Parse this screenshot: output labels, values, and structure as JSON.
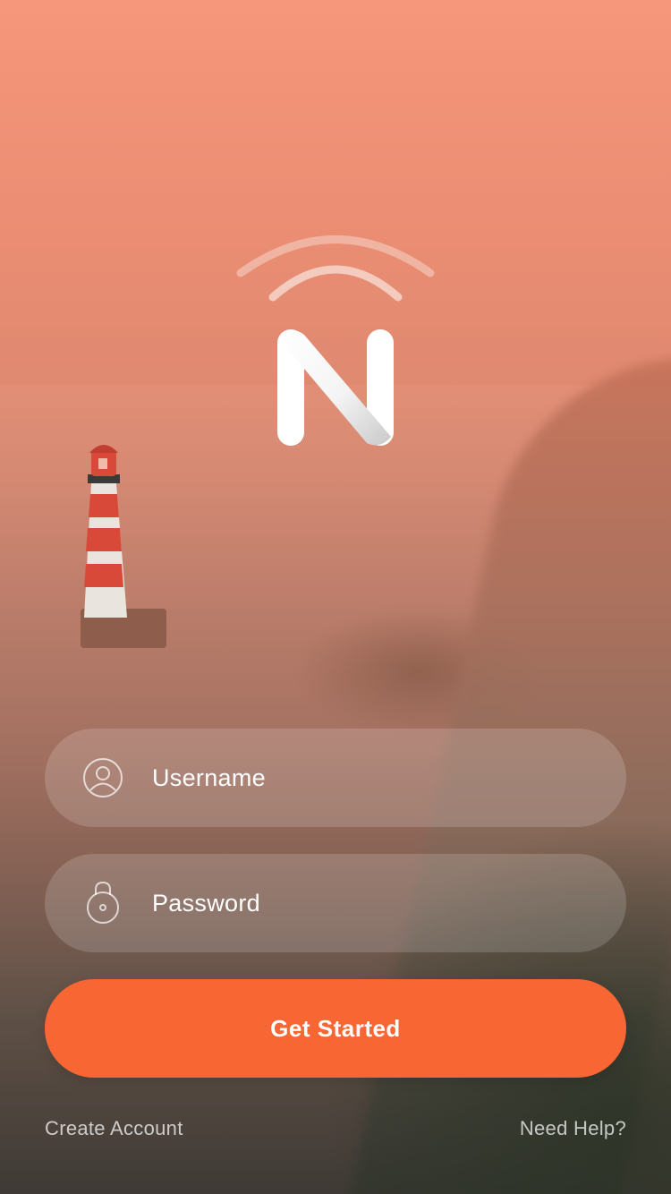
{
  "app": {
    "logo_letter": "N"
  },
  "form": {
    "username_placeholder": "Username",
    "password_placeholder": "Password",
    "submit_label": "Get Started"
  },
  "footer": {
    "create_account_label": "Create Account",
    "help_label": "Need Help?"
  },
  "colors": {
    "accent": "#f86634",
    "background_top": "#f6967a",
    "field_fill": "rgba(255,255,255,0.16)"
  },
  "icons": {
    "username": "user-icon",
    "password": "lock-icon",
    "logo_signal": "signal-arcs-icon"
  }
}
